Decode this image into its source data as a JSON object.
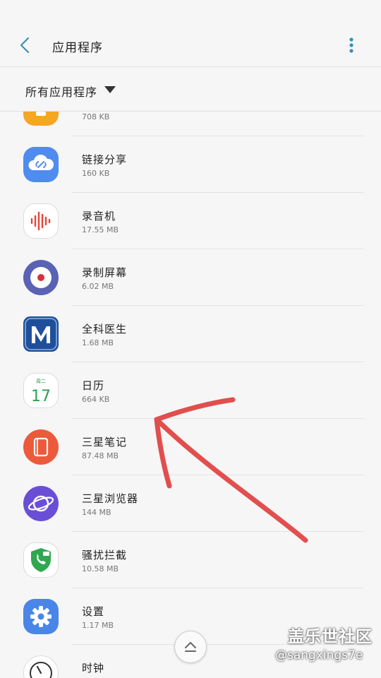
{
  "header": {
    "title": "应用程序"
  },
  "filter": {
    "label": "所有应用程序"
  },
  "apps": [
    {
      "name": "",
      "size": "708 KB",
      "icon": "partial-orange-icon"
    },
    {
      "name": "链接分享",
      "size": "160 KB",
      "icon": "link-sharing-cloud-icon"
    },
    {
      "name": "录音机",
      "size": "17.55 MB",
      "icon": "voice-recorder-icon"
    },
    {
      "name": "录制屏幕",
      "size": "6.02 MB",
      "icon": "screen-recorder-icon"
    },
    {
      "name": "全科医生",
      "size": "1.68 MB",
      "icon": "m-doctor-icon"
    },
    {
      "name": "日历",
      "size": "664 KB",
      "icon": "calendar-icon",
      "calendar_day": "17",
      "calendar_weekday": "周二"
    },
    {
      "name": "三星笔记",
      "size": "87.48 MB",
      "icon": "samsung-notes-icon"
    },
    {
      "name": "三星浏览器",
      "size": "144 MB",
      "icon": "samsung-internet-icon"
    },
    {
      "name": "骚扰拦截",
      "size": "10.58 MB",
      "icon": "call-block-icon"
    },
    {
      "name": "设置",
      "size": "1.17 MB",
      "icon": "settings-gear-icon"
    },
    {
      "name": "时钟",
      "size": "",
      "icon": "clock-icon"
    }
  ],
  "watermark": {
    "line1": "盖乐世社区",
    "line2": "@sangxings7e"
  },
  "colors": {
    "accent": "#3a8fb7",
    "annotation": "#e0403f"
  }
}
